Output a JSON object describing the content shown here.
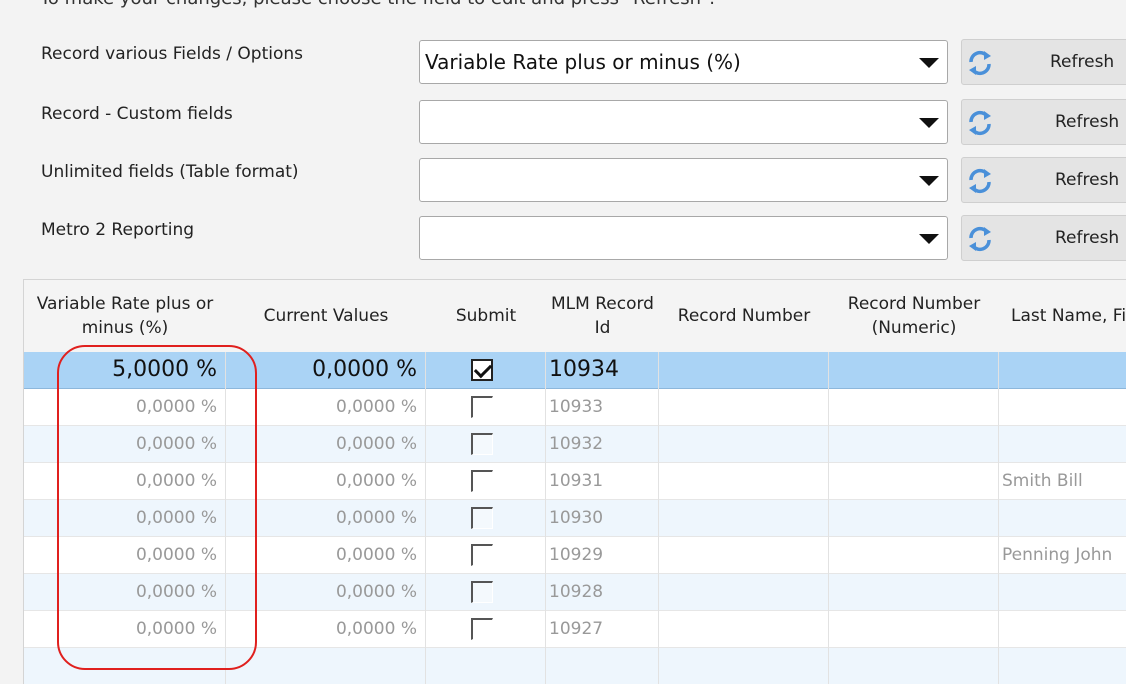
{
  "instructions": "To make your changes, please choose the field to edit and press \"Refresh\".",
  "form_rows": [
    {
      "label": "Record various Fields / Options",
      "value": "Variable Rate plus or minus (%)",
      "button": "Refresh"
    },
    {
      "label": "Record - Custom fields",
      "value": "",
      "button": "Refresh"
    },
    {
      "label": "Unlimited fields (Table format)",
      "value": "",
      "button": "Refresh"
    },
    {
      "label": "Metro 2 Reporting",
      "value": "",
      "button": "Refresh"
    }
  ],
  "grid": {
    "columns": [
      "Variable Rate plus or minus (%)",
      "Current Values",
      "Submit",
      "MLM Record Id",
      "Record Number",
      "Record Number (Numeric)",
      "Last Name, Firs"
    ],
    "rows": [
      {
        "variable_rate": "5,0000 %",
        "current": "0,0000 %",
        "submit": true,
        "mlm_id": "10934",
        "record_number": "",
        "record_numeric": "",
        "name": "",
        "selected": true
      },
      {
        "variable_rate": "0,0000 %",
        "current": "0,0000 %",
        "submit": false,
        "mlm_id": "10933",
        "record_number": "",
        "record_numeric": "",
        "name": ""
      },
      {
        "variable_rate": "0,0000 %",
        "current": "0,0000 %",
        "submit": false,
        "mlm_id": "10932",
        "record_number": "",
        "record_numeric": "",
        "name": ""
      },
      {
        "variable_rate": "0,0000 %",
        "current": "0,0000 %",
        "submit": false,
        "mlm_id": "10931",
        "record_number": "",
        "record_numeric": "",
        "name": "Smith Bill"
      },
      {
        "variable_rate": "0,0000 %",
        "current": "0,0000 %",
        "submit": false,
        "mlm_id": "10930",
        "record_number": "",
        "record_numeric": "",
        "name": ""
      },
      {
        "variable_rate": "0,0000 %",
        "current": "0,0000 %",
        "submit": false,
        "mlm_id": "10929",
        "record_number": "",
        "record_numeric": "",
        "name": "Penning John"
      },
      {
        "variable_rate": "0,0000 %",
        "current": "0,0000 %",
        "submit": false,
        "mlm_id": "10928",
        "record_number": "",
        "record_numeric": "",
        "name": ""
      },
      {
        "variable_rate": "0,0000 %",
        "current": "0,0000 %",
        "submit": false,
        "mlm_id": "10927",
        "record_number": "",
        "record_numeric": "",
        "name": ""
      }
    ]
  },
  "colors": {
    "selected_row": "#aad3f5",
    "alt_row": "#eef6fd",
    "annotation": "#e0201e",
    "refresh_icon": "#4a90d9"
  },
  "icons": {
    "refresh": "refresh-icon",
    "dropdown": "chevron-down-icon",
    "checkbox": "checkbox-icon"
  }
}
